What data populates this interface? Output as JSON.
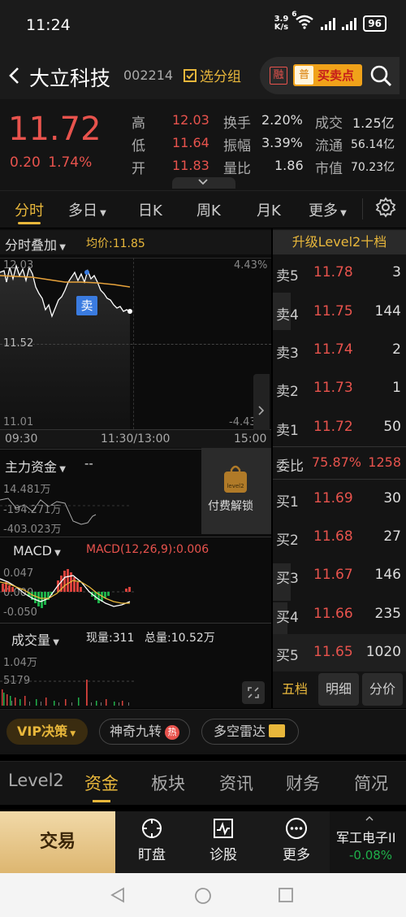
{
  "status_bar": {
    "time": "11:24",
    "net_speed": "3.9",
    "net_unit": "K/s",
    "wifi_badge": "6",
    "battery": "96"
  },
  "header": {
    "stock_name": "大立科技",
    "stock_code": "002214",
    "add_watch_label": "选分组",
    "margin_label": "融",
    "buy_sell_badge": "普",
    "buy_sell_label": "买卖点"
  },
  "quote": {
    "price": "11.72",
    "change": "0.20",
    "change_pct": "1.74%",
    "stats": [
      {
        "label": "高",
        "value": "12.03"
      },
      {
        "label": "低",
        "value": "11.64"
      },
      {
        "label": "开",
        "value": "11.83"
      },
      {
        "label": "换手",
        "value": "2.20%"
      },
      {
        "label": "振幅",
        "value": "3.39%"
      },
      {
        "label": "量比",
        "value": "1.86"
      },
      {
        "label": "成交",
        "value": "1.25亿"
      },
      {
        "label": "流通",
        "value": "56.14亿"
      },
      {
        "label": "市值",
        "value": "70.23亿"
      }
    ]
  },
  "period_tabs": [
    "分时",
    "多日",
    "日K",
    "周K",
    "月K",
    "更多"
  ],
  "intraday": {
    "overlay_label": "分时叠加",
    "avg_label": "均价:11.85",
    "y_top": "12.03",
    "y_mid": "11.52",
    "y_bottom": "11.01",
    "pct_top": "4.43%",
    "pct_bottom": "-4.43%",
    "sell_marker": "卖",
    "time_labels": [
      "09:30",
      "11:30/13:00",
      "15:00"
    ]
  },
  "capital": {
    "label": "主力资金",
    "value": "--",
    "y_labels": [
      "14.481万",
      "-194.271万",
      "-403.023万"
    ],
    "unlock_label": "付费解锁",
    "lock_text": "level2"
  },
  "macd": {
    "label": "MACD",
    "params": "MACD(12,26,9):0.006",
    "y_labels": [
      "0.047",
      "0.000",
      "-0.050"
    ]
  },
  "volume": {
    "label": "成交量",
    "current": "现量:311",
    "total": "总量:10.52万",
    "y_labels": [
      "1.04万",
      "5179"
    ]
  },
  "orderbook": {
    "upgrade_label": "升级Level2十档",
    "asks": [
      {
        "label": "卖5",
        "price": "11.78",
        "vol": "3"
      },
      {
        "label": "卖4",
        "price": "11.75",
        "vol": "144"
      },
      {
        "label": "卖3",
        "price": "11.74",
        "vol": "2"
      },
      {
        "label": "卖2",
        "price": "11.73",
        "vol": "1"
      },
      {
        "label": "卖1",
        "price": "11.72",
        "vol": "50"
      }
    ],
    "ratio_label": "委比",
    "ratio_pct": "75.87%",
    "ratio_vol": "1258",
    "bids": [
      {
        "label": "买1",
        "price": "11.69",
        "vol": "30"
      },
      {
        "label": "买2",
        "price": "11.68",
        "vol": "27"
      },
      {
        "label": "买3",
        "price": "11.67",
        "vol": "146"
      },
      {
        "label": "买4",
        "price": "11.66",
        "vol": "235"
      },
      {
        "label": "买5",
        "price": "11.65",
        "vol": "1020"
      }
    ],
    "tabs": [
      "五档",
      "明细",
      "分价"
    ]
  },
  "features": {
    "vip": "VIP决策",
    "magic": "神奇九转",
    "hot_badge": "热",
    "radar": "多空雷达"
  },
  "info_tabs": [
    "Level2",
    "资金",
    "板块",
    "资讯",
    "财务",
    "简况"
  ],
  "actions": {
    "trade": "交易",
    "watch": "盯盘",
    "diagnose": "诊股",
    "more": "更多",
    "related_name": "军工电子II",
    "related_change": "-0.08%"
  },
  "colors": {
    "up": "#e8534d",
    "down": "#1fb04a",
    "accent": "#e8b73b"
  }
}
